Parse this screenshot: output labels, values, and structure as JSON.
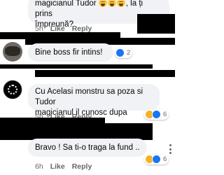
{
  "comments": [
    {
      "line1": "magicianul Tudor",
      "line1_suffix": ", la ți prins",
      "line2": "împreună?",
      "time": "5h",
      "like": "Like",
      "reply": "Reply"
    },
    {
      "text": "Bine boss fir intins!",
      "reaction_count": "2"
    },
    {
      "line1": "Cu Acelasi monstru sa poza si Tudor",
      "line2": "magicianul il cunosc dupa mustati",
      "reaction_count": "6",
      "time": "5h",
      "like": "Like",
      "reply": "Reply"
    },
    {
      "text": "Bravo ! Sa ti-o traga la fund ..",
      "reaction_count": "6",
      "time": "6h",
      "like": "Like",
      "reply": "Reply"
    }
  ],
  "colors": {
    "bubble": "#f0f2f5",
    "meta": "#65676b",
    "like_blue": "#1877f2",
    "haha_yellow": "#f7b125",
    "redaction": "#000000"
  },
  "icons": [
    "laughing-emoji",
    "like-reaction",
    "haha-reaction",
    "more-options-dots"
  ]
}
